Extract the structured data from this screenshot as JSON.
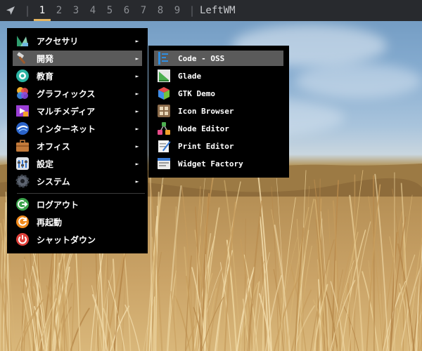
{
  "topbar": {
    "launcher_icon": "send-arrow-icon",
    "separator": "|",
    "workspaces": [
      "1",
      "2",
      "3",
      "4",
      "5",
      "6",
      "7",
      "8",
      "9"
    ],
    "active_workspace": "1",
    "window_title": "LeftWM"
  },
  "main_menu": {
    "items": [
      {
        "label": "アクセサリ",
        "icon": "accessories-icon",
        "submenu": true
      },
      {
        "label": "開発",
        "icon": "development-hammer-icon",
        "submenu": true,
        "highlighted": true
      },
      {
        "label": "教育",
        "icon": "education-icon",
        "submenu": true
      },
      {
        "label": "グラフィックス",
        "icon": "graphics-icon",
        "submenu": true
      },
      {
        "label": "マルチメディア",
        "icon": "multimedia-icon",
        "submenu": true
      },
      {
        "label": "インターネット",
        "icon": "internet-globe-icon",
        "submenu": true
      },
      {
        "label": "オフィス",
        "icon": "office-briefcase-icon",
        "submenu": true
      },
      {
        "label": "設定",
        "icon": "settings-icon",
        "submenu": true
      },
      {
        "label": "システム",
        "icon": "system-gear-icon",
        "submenu": true
      }
    ],
    "power_items": [
      {
        "label": "ログアウト",
        "icon": "logout-icon"
      },
      {
        "label": "再起動",
        "icon": "reboot-icon"
      },
      {
        "label": "シャットダウン",
        "icon": "shutdown-icon"
      }
    ],
    "submenu_arrow": "►"
  },
  "sub_menu": {
    "items": [
      {
        "label": "Code - OSS",
        "icon": "code-oss-icon",
        "highlighted": true
      },
      {
        "label": "Glade",
        "icon": "glade-icon"
      },
      {
        "label": "GTK Demo",
        "icon": "gtk-demo-icon"
      },
      {
        "label": "Icon Browser",
        "icon": "icon-browser-icon"
      },
      {
        "label": "Node Editor",
        "icon": "node-editor-icon"
      },
      {
        "label": "Print Editor",
        "icon": "print-editor-icon"
      },
      {
        "label": "Widget Factory",
        "icon": "widget-factory-icon"
      }
    ]
  },
  "colors": {
    "bar_bg": "#282a2e",
    "workspace_indicator": "#e6b55f",
    "menu_bg": "#000000",
    "menu_highlight": "#5a5a5a"
  }
}
